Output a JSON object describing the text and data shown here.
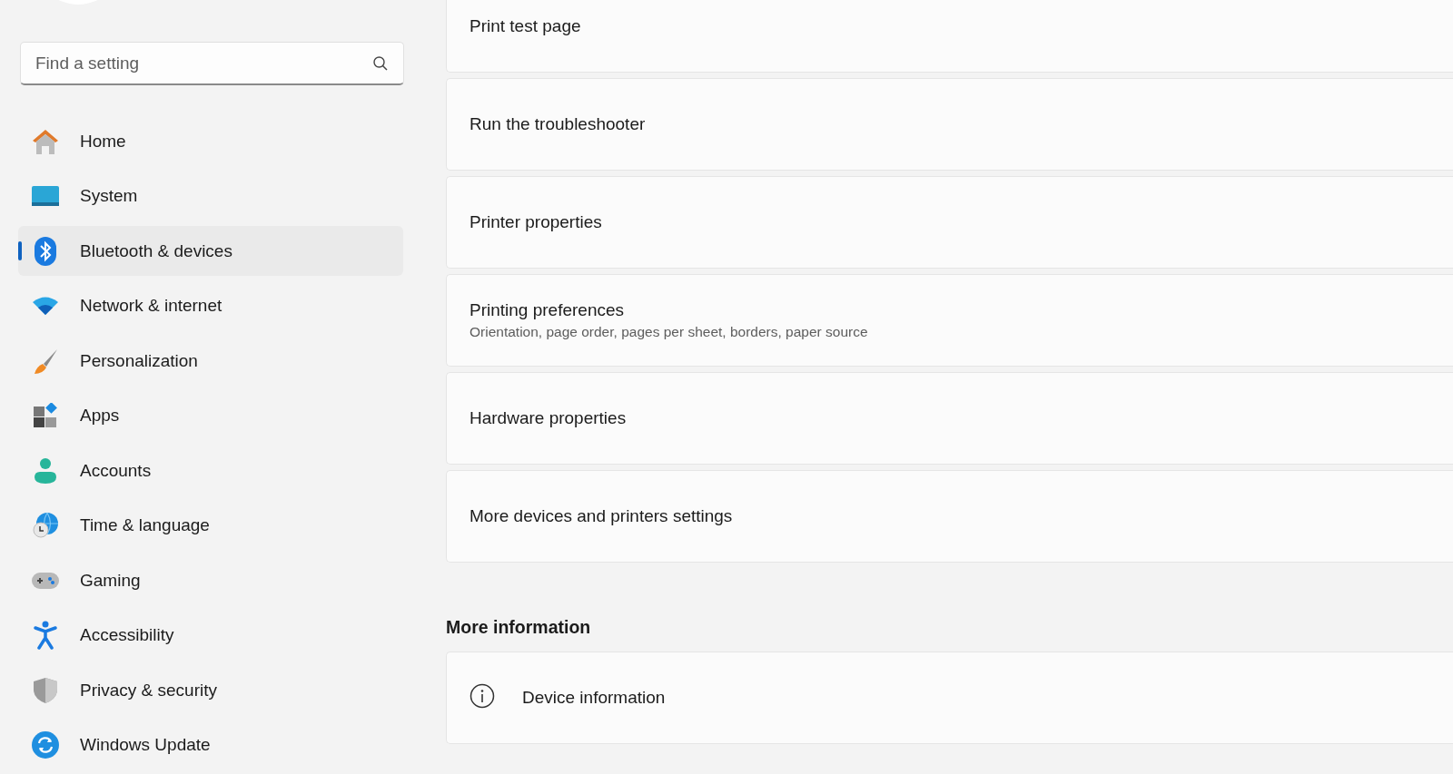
{
  "search": {
    "placeholder": "Find a setting"
  },
  "nav": [
    {
      "label": "Home",
      "kind": "home",
      "selected": false
    },
    {
      "label": "System",
      "kind": "system",
      "selected": false
    },
    {
      "label": "Bluetooth & devices",
      "kind": "bluetooth",
      "selected": true
    },
    {
      "label": "Network & internet",
      "kind": "network",
      "selected": false
    },
    {
      "label": "Personalization",
      "kind": "brush",
      "selected": false
    },
    {
      "label": "Apps",
      "kind": "apps",
      "selected": false
    },
    {
      "label": "Accounts",
      "kind": "accounts",
      "selected": false
    },
    {
      "label": "Time & language",
      "kind": "time",
      "selected": false
    },
    {
      "label": "Gaming",
      "kind": "gaming",
      "selected": false
    },
    {
      "label": "Accessibility",
      "kind": "accessibility",
      "selected": false
    },
    {
      "label": "Privacy & security",
      "kind": "shield",
      "selected": false
    },
    {
      "label": "Windows Update",
      "kind": "update",
      "selected": false
    }
  ],
  "cards": [
    {
      "title": "Print test page"
    },
    {
      "title": "Run the troubleshooter"
    },
    {
      "title": "Printer properties"
    },
    {
      "title": "Printing preferences",
      "subtitle": "Orientation, page order, pages per sheet, borders, paper source"
    },
    {
      "title": "Hardware properties"
    },
    {
      "title": "More devices and printers settings"
    }
  ],
  "more_information": {
    "heading": "More information",
    "cards": [
      {
        "title": "Device information",
        "kind": "info"
      }
    ]
  }
}
